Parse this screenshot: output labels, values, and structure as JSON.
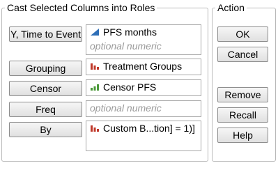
{
  "cast_group": {
    "title": "Cast Selected Columns into Roles",
    "roles": [
      {
        "button": "Y, Time to Event",
        "items": [
          {
            "text": "PFS months",
            "icon": "continuous-column-icon",
            "color": "#2f6fb7"
          }
        ],
        "placeholder": "optional numeric"
      },
      {
        "button": "Grouping",
        "items": [
          {
            "text": "Treatment Groups",
            "icon": "nominal-column-icon",
            "color": "#c0392b"
          }
        ],
        "placeholder": ""
      },
      {
        "button": "Censor",
        "items": [
          {
            "text": "Censor PFS",
            "icon": "ordinal-column-icon",
            "color": "#4c9a3b"
          }
        ],
        "placeholder": ""
      },
      {
        "button": "Freq",
        "items": [],
        "placeholder": "optional numeric"
      },
      {
        "button": "By",
        "items": [
          {
            "text": "Custom B...tion] = 1)]",
            "icon": "nominal-column-icon",
            "color": "#c0392b"
          }
        ],
        "placeholder": ""
      }
    ]
  },
  "action_group": {
    "title": "Action",
    "buttons": [
      "OK",
      "Cancel",
      "Remove",
      "Recall",
      "Help"
    ]
  }
}
